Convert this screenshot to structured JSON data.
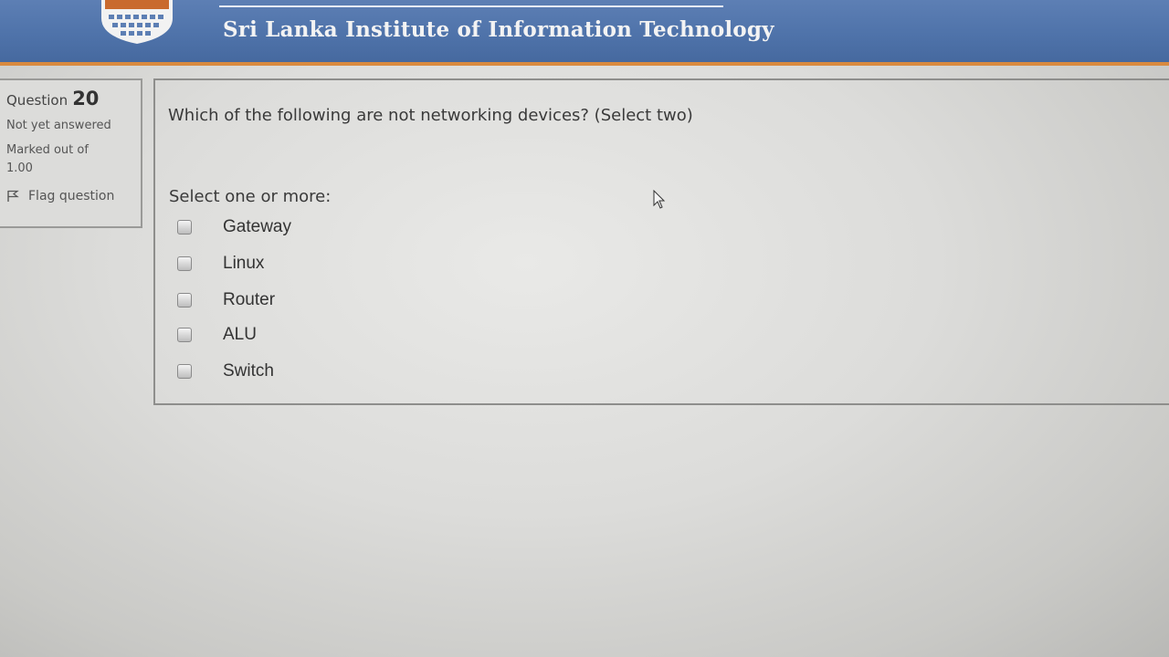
{
  "header": {
    "title": "Sri Lanka Institute of Information Technology",
    "logo_text": "SLIIT"
  },
  "info": {
    "question_label": "Question",
    "question_number": "20",
    "status": "Not yet answered",
    "marked_out_of_label": "Marked out of",
    "marked_out_of_value": "1.00",
    "flag_label": "Flag question"
  },
  "question": {
    "text": "Which of the following are not networking devices? (Select two)",
    "instruction": "Select one or more:",
    "options": [
      {
        "label": "Gateway",
        "checked": false
      },
      {
        "label": "Linux",
        "checked": false
      },
      {
        "label": "Router",
        "checked": false
      },
      {
        "label": "ALU",
        "checked": false
      },
      {
        "label": "Switch",
        "checked": false
      }
    ]
  },
  "colors": {
    "header_bg": "#4f73aa",
    "header_accent": "#d98a3f",
    "page_bg": "#dcdcda"
  },
  "icons": {
    "flag": "flag-icon",
    "logo": "sliit-logo-icon",
    "cursor": "mouse-pointer-icon"
  }
}
